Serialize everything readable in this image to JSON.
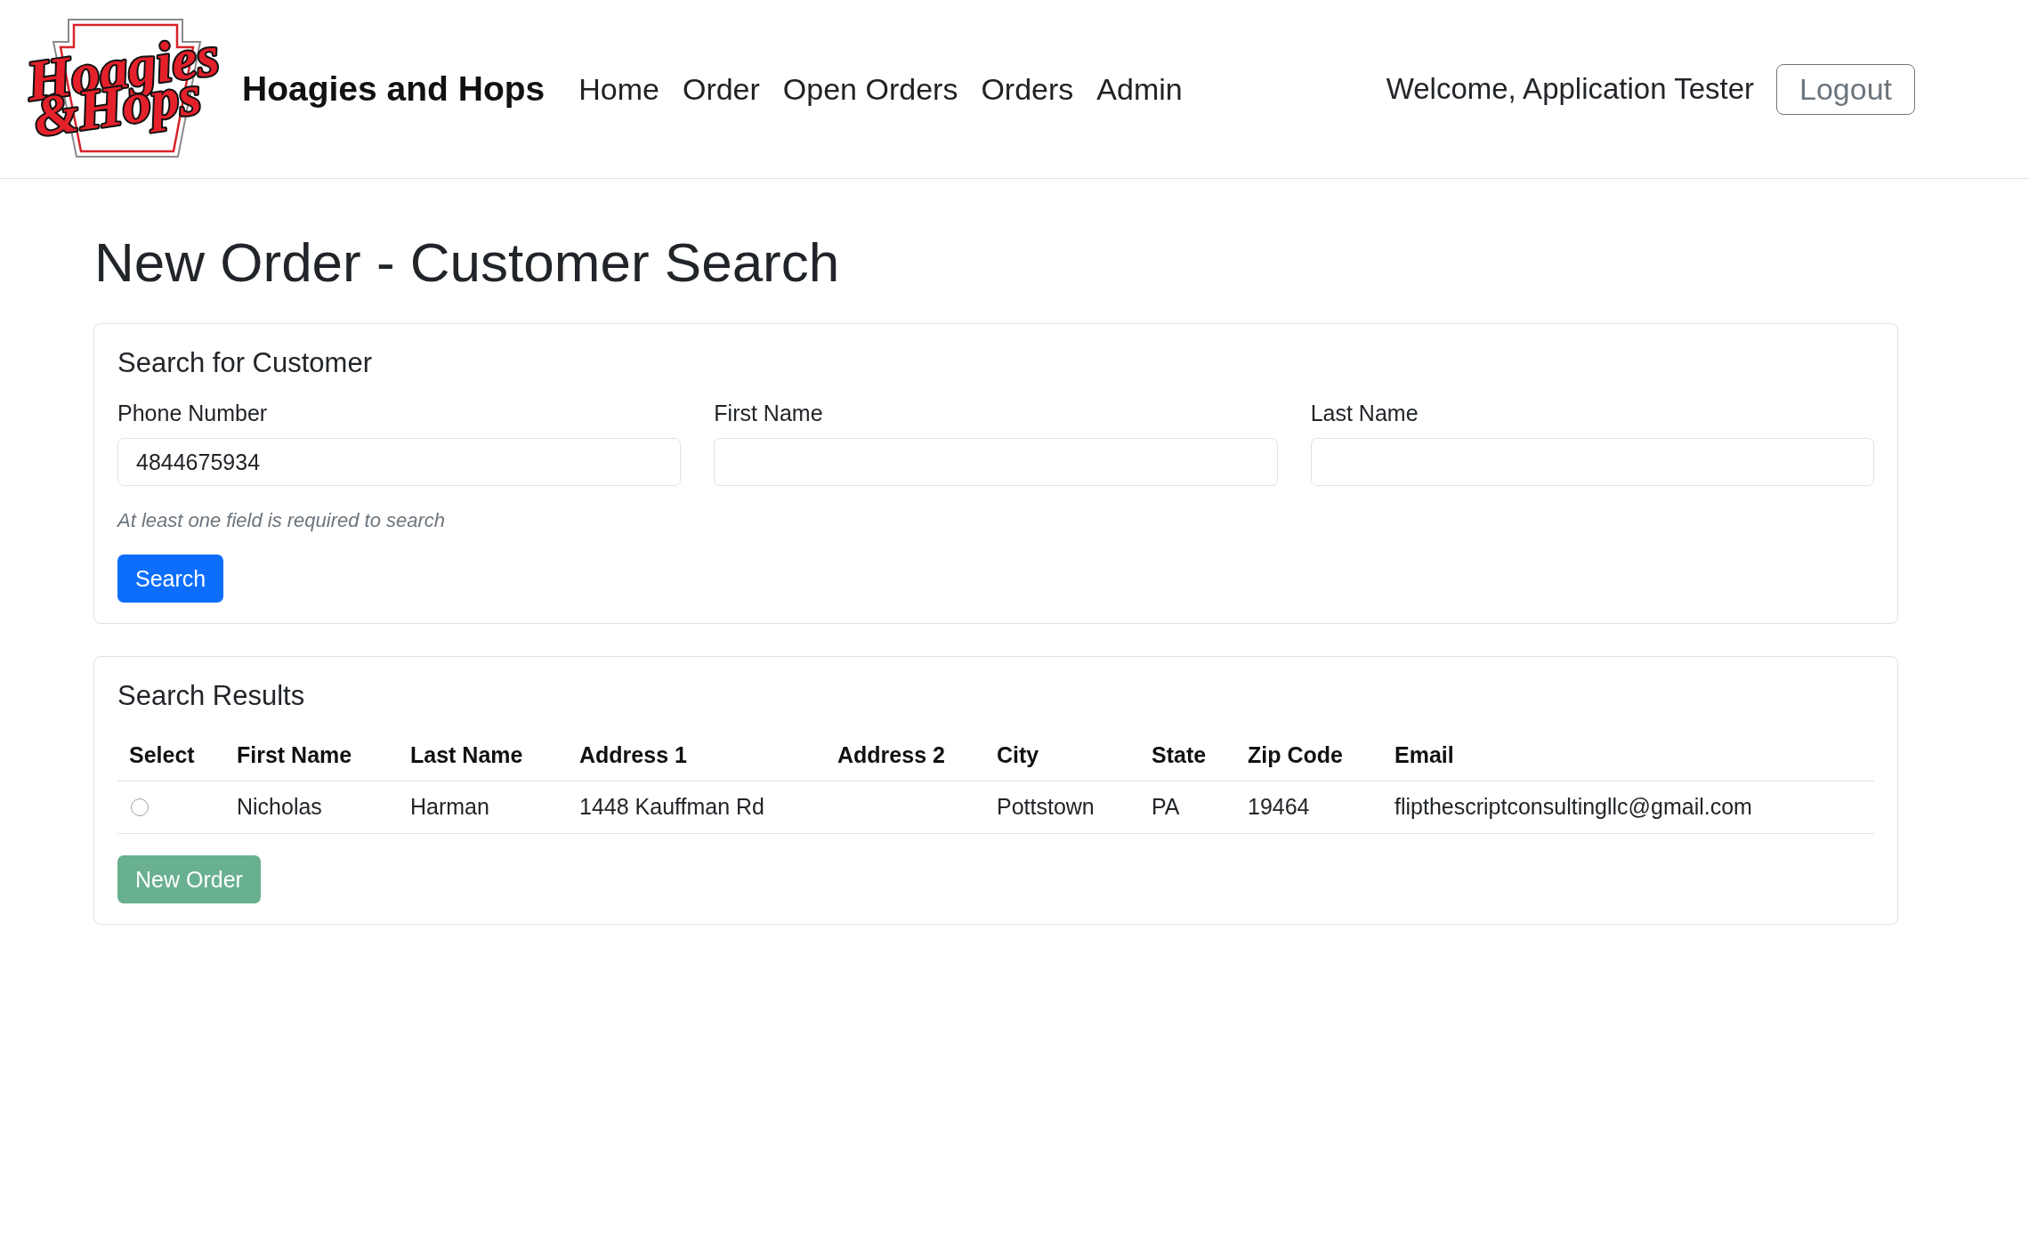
{
  "header": {
    "logo": {
      "lines": [
        "Hoagies",
        "&Hops"
      ]
    },
    "brand": "Hoagies and Hops",
    "nav": [
      {
        "label": "Home"
      },
      {
        "label": "Order"
      },
      {
        "label": "Open Orders"
      },
      {
        "label": "Orders"
      },
      {
        "label": "Admin"
      }
    ],
    "welcome": "Welcome, Application Tester",
    "logout": "Logout"
  },
  "page_title": "New Order - Customer Search",
  "search_card": {
    "title": "Search for Customer",
    "fields": [
      {
        "label": "Phone Number",
        "value": "4844675934"
      },
      {
        "label": "First Name"
      },
      {
        "label": "Last Name"
      }
    ],
    "hint": "At least one field is required to search",
    "button": {
      "label": "Search"
    }
  },
  "results_card": {
    "title": "Search Results",
    "table": {
      "columns": [
        "Select",
        "First Name",
        "Last Name",
        "Address 1",
        "Address 2",
        "City",
        "State",
        "Zip Code",
        "Email"
      ],
      "rows": [
        {
          "selected": false,
          "cells": [
            "",
            "Nicholas",
            "Harman",
            "1448 Kauffman Rd",
            "",
            "Pottstown",
            "PA",
            "19464",
            "flipthescriptconsultingllc@gmail.com"
          ]
        }
      ]
    },
    "button": {
      "label": "New Order",
      "disabled": true
    }
  }
}
